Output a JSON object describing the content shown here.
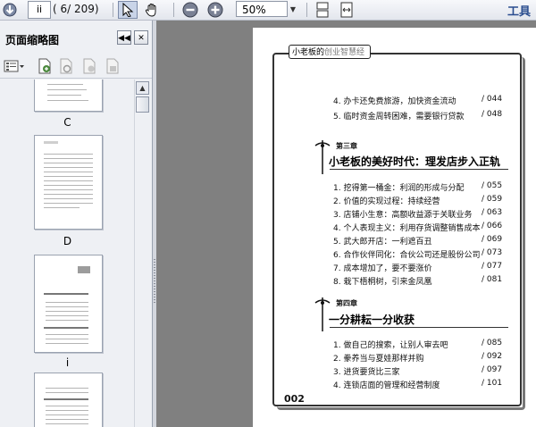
{
  "toolbar": {
    "page_input": "ii",
    "page_count": "( 6/ 209)",
    "zoom_value": "50%",
    "tools_label": "工具"
  },
  "sidebar": {
    "title": "页面缩略图",
    "thumbnail_labels": [
      "C",
      "D",
      "i"
    ]
  },
  "document": {
    "header_prefix": "小老板的",
    "header_highlight": "创业智慧经",
    "page_number": "002",
    "entries_top": [
      {
        "text": "4. 办卡还免费旅游，加快资金流动",
        "page": "/ 044"
      },
      {
        "text": "5. 临时资金周转困难，需要银行贷款",
        "page": "/ 048"
      }
    ],
    "chapter3": {
      "number": "第三章",
      "title": "小老板的美好时代：理发店步入正轨",
      "entries": [
        {
          "text": "1. 挖得第一桶金：利润的形成与分配",
          "page": "/ 055"
        },
        {
          "text": "2. 价值的实现过程：持续经营",
          "page": "/ 059"
        },
        {
          "text": "3. 店铺小生意：高额收益源于关联业务",
          "page": "/ 063"
        },
        {
          "text": "4. 个人表现主义：利用存货调整销售成本",
          "page": "/ 066"
        },
        {
          "text": "5. 武大郎开店：一利遮百丑",
          "page": "/ 069"
        },
        {
          "text": "6. 合作伙伴同化：合伙公司还是股份公司",
          "page": "/ 073"
        },
        {
          "text": "7. 成本增加了，要不要涨价",
          "page": "/ 077"
        },
        {
          "text": "8. 栽下梧桐树，引来金凤凰",
          "page": "/ 081"
        }
      ]
    },
    "chapter4": {
      "number": "第四章",
      "title": "一分耕耘一分收获",
      "entries": [
        {
          "text": "1. 做自己的搜索，让别人审去吧",
          "page": "/ 085"
        },
        {
          "text": "2. 豢养当与夏娃那样并购",
          "page": "/ 092"
        },
        {
          "text": "3. 进货要货比三家",
          "page": "/ 097"
        },
        {
          "text": "4. 连锁店面的管理和经营制度",
          "page": "/ 101"
        }
      ]
    }
  }
}
